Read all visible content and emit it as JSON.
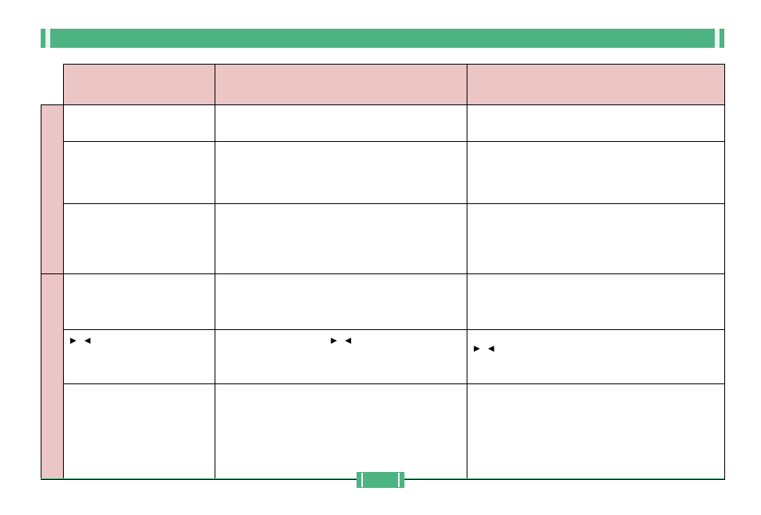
{
  "title_bar": "",
  "col_headers": [
    "",
    "",
    ""
  ],
  "row_group_labels": [
    "",
    ""
  ],
  "rows": [
    {
      "cells": [
        "",
        "",
        ""
      ]
    },
    {
      "cells": [
        "",
        "",
        ""
      ]
    },
    {
      "cells": [
        "",
        "",
        ""
      ]
    },
    {
      "cells": [
        "",
        "",
        ""
      ]
    },
    {
      "cells": [
        "▶  ◀",
        "▶  ◀",
        "▶  ◀"
      ]
    },
    {
      "cells": [
        "",
        "",
        ""
      ]
    }
  ],
  "footer": {
    "page_number": ""
  }
}
